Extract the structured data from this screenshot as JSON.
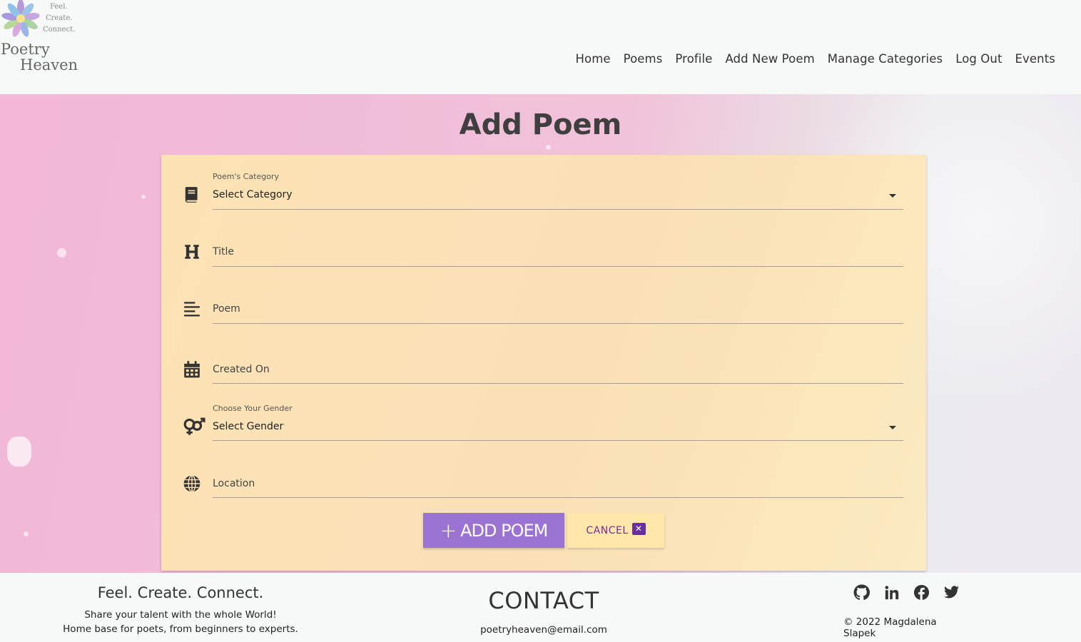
{
  "logo": {
    "tagline_1": "Feel.",
    "tagline_2": "Create.",
    "tagline_3": "Connect.",
    "title_1": "Poetry",
    "title_2": "Heaven"
  },
  "nav": {
    "items": [
      "Home",
      "Poems",
      "Profile",
      "Add New Poem",
      "Manage Categories",
      "Log Out",
      "Events"
    ]
  },
  "page": {
    "title": "Add Poem"
  },
  "form": {
    "category": {
      "label": "Poem's Category",
      "value": "Select Category",
      "icon": "book-icon"
    },
    "title": {
      "placeholder": "Title",
      "icon": "heading-icon"
    },
    "poem": {
      "placeholder": "Poem",
      "icon": "align-left-icon"
    },
    "created_on": {
      "placeholder": "Created On",
      "icon": "calendar-icon"
    },
    "gender": {
      "label": "Choose Your Gender",
      "value": "Select Gender",
      "icon": "gender-icon"
    },
    "location": {
      "placeholder": "Location",
      "icon": "globe-icon"
    },
    "add_button": {
      "label": "ADD POEM",
      "icon": "plus-icon"
    },
    "cancel_button": {
      "label": "CANCEL",
      "icon": "close-icon"
    }
  },
  "footer": {
    "slogan": "Feel. Create. Connect.",
    "line_1": "Share your talent with the whole World!",
    "line_2": "Home base for poets, from beginners to experts.",
    "contact_heading": "CONTACT",
    "email": "poetryheaven@email.com",
    "socials": [
      "github-icon",
      "linkedin-icon",
      "facebook-icon",
      "twitter-icon"
    ],
    "copyright": "© 2022 Magdalena Slapek"
  },
  "colors": {
    "accent_purple": "#9b74d3",
    "cancel_bg": "#fde7a9",
    "cancel_text": "#7b2a9c",
    "card_bg": "#fde3b4",
    "pink_bg": "#f3b8d5"
  }
}
